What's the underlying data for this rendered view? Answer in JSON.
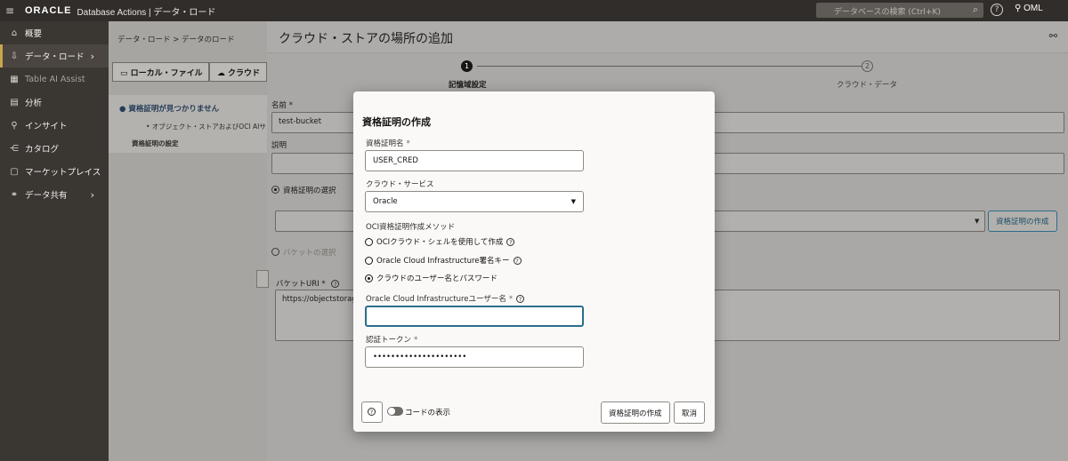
{
  "topbar": {
    "brand": "ORACLE",
    "product": "Database Actions | データ・ロード",
    "search_placeholder": "データベースの検索 (Ctrl+K)",
    "user": "OML"
  },
  "sidebar": {
    "items": [
      {
        "label": "概要",
        "icon": "home-icon"
      },
      {
        "label": "データ・ロード",
        "icon": "data-load-icon",
        "active": true
      },
      {
        "label": "Table AI Assist",
        "icon": "table-ai-icon"
      },
      {
        "label": "分析",
        "icon": "analysis-icon"
      },
      {
        "label": "インサイト",
        "icon": "insight-icon"
      },
      {
        "label": "カタログ",
        "icon": "catalog-icon"
      },
      {
        "label": "マーケットプレイス",
        "icon": "marketplace-icon"
      },
      {
        "label": "データ共有",
        "icon": "data-share-icon"
      }
    ]
  },
  "underlay": {
    "breadcrumb": "データ・ロード > データのロード",
    "tab_local": "ローカル・ファイル",
    "tab_cloud": "クラウド",
    "message": "資格証明が見つかりません",
    "bullet": "オブジェクト・ストアおよびOCI AIサ",
    "settings": "資格証明の設定"
  },
  "drawer": {
    "title": "クラウド・ストアの場所の追加",
    "step1_num": "1",
    "step1_label": "記憶域設定",
    "step2_num": "2",
    "step2_label": "クラウド・データ",
    "name_label": "名前",
    "name_value": "test-bucket",
    "desc_label": "説明",
    "radio_credential": "資格証明の選択",
    "create_credential_button": "資格証明の作成",
    "radio_bucket": "バケットの選択",
    "bucket_uri_label": "バケットURI",
    "bucket_uri_value": "https://objectstorage"
  },
  "modal": {
    "title": "資格証明の作成",
    "cred_name_label": "資格証明名",
    "cred_name_value": "USER_CRED",
    "cloud_service_label": "クラウド・サービス",
    "cloud_service_value": "Oracle",
    "method_label": "OCI資格証明作成メソッド",
    "method_options": [
      {
        "label": "OCIクラウド・シェルを使用して作成",
        "selected": false,
        "help": true
      },
      {
        "label": "Oracle Cloud Infrastructure署名キー",
        "selected": false,
        "help": true
      },
      {
        "label": "クラウドのユーザー名とパスワード",
        "selected": true,
        "help": false
      }
    ],
    "username_label": "Oracle Cloud Infrastructureユーザー名",
    "username_value": "",
    "token_label": "認証トークン",
    "token_value": "•••••••••••••••••••••",
    "show_code_label": "コードの表示",
    "create_button": "資格証明の作成",
    "cancel_button": "取消"
  }
}
